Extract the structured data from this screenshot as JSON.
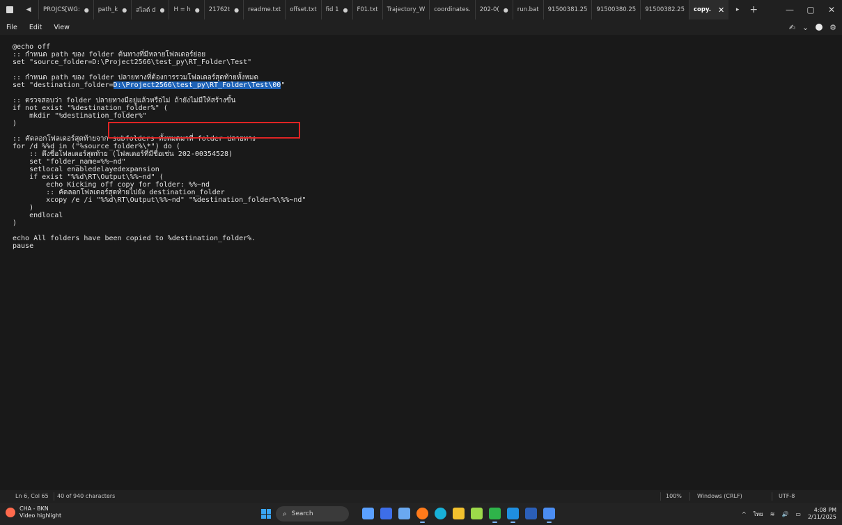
{
  "tabs": [
    {
      "label": "PROJCS[WG:",
      "dirty": "●"
    },
    {
      "label": "path_k",
      "dirty": "●"
    },
    {
      "label": "สไลด์ d",
      "dirty": "●"
    },
    {
      "label": "H = h",
      "dirty": "●"
    },
    {
      "label": "21762t",
      "dirty": "●"
    },
    {
      "label": "readme.txt",
      "dirty": ""
    },
    {
      "label": "offset.txt",
      "dirty": ""
    },
    {
      "label": "fid 1",
      "dirty": "●"
    },
    {
      "label": "F01.txt",
      "dirty": ""
    },
    {
      "label": "Trajectory_W",
      "dirty": ""
    },
    {
      "label": "coordinates.",
      "dirty": ""
    },
    {
      "label": "202-0(",
      "dirty": "●"
    },
    {
      "label": "run.bat",
      "dirty": ""
    },
    {
      "label": "91500381.25",
      "dirty": ""
    },
    {
      "label": "91500380.25",
      "dirty": ""
    },
    {
      "label": "91500382.25",
      "dirty": ""
    }
  ],
  "active_tab": {
    "label": "copy.",
    "close": "✕"
  },
  "tab_controls": {
    "back": "◀",
    "more": "▸",
    "add": "+"
  },
  "window_controls": {
    "minimize": "—",
    "maximize": "▢",
    "close": "✕"
  },
  "menu": {
    "file": "File",
    "edit": "Edit",
    "view": "View"
  },
  "menu_right": {
    "copilot": "✍",
    "chevron": "⌄",
    "settings": "⚙"
  },
  "code": {
    "before_selection": "@echo off\n:: กำหนด path ของ folder ต้นทางที่มีหลายโฟลเดอร์ย่อย\nset \"source_folder=D:\\Project2566\\test_py\\RT_Folder\\Test\"\n\n:: กำหนด path ของ folder ปลายทางที่ต้องการรวมโฟลเดอร์สุดท้ายทั้งหมด\nset \"destination_folder=",
    "selection": "D:\\Project2566\\test_py\\RT_Folder\\Test\\00",
    "after_selection": "\"\n\n:: ตรวจสอบว่า folder ปลายทางมีอยู่แล้วหรือไม่ ถ้ายังไม่มีให้สร้างขึ้น\nif not exist \"%destination_folder%\" (\n    mkdir \"%destination_folder%\"\n)\n\n:: คัดลอกโฟลเดอร์สุดท้ายจาก subfolders ทั้งหมดมาที่ folder ปลายทาง\nfor /d %%d in (\"%source_folder%\\*\") do (\n    :: ดึงชื่อโฟลเดอร์สุดท้าย (โฟลเดอร์ที่มีชื่อเช่น 202-00354528)\n    set \"folder_name=%%~nd\"\n    setlocal enabledelayedexpansion\n    if exist \"%%d\\RT\\Output\\%%~nd\" (\n        echo Kicking off copy for folder: %%~nd\n        :: คัดลอกโฟลเดอร์สุดท้ายไปยัง destination_folder\n        xcopy /e /i \"%%d\\RT\\Output\\%%~nd\" \"%destination_folder%\\%%~nd\"\n    )\n    endlocal\n)\n\necho All folders have been copied to %destination_folder%.\npause"
  },
  "status": {
    "position": "Ln 6, Col 65",
    "selection": "40 of 940 characters",
    "zoom": "100%",
    "line_ending": "Windows (CRLF)",
    "encoding": "UTF-8"
  },
  "taskbar": {
    "weather_title": "CHA - BKN",
    "weather_sub": "Video highlight",
    "search": "Search",
    "tray_chevron": "^",
    "lang": "ไทย",
    "wifi": "≋",
    "volume": "🔊",
    "battery": "▭",
    "time": "4:08 PM",
    "date": "2/11/2025"
  },
  "colors": {
    "selection": "#1d62b8",
    "annotation_box": "#e02424",
    "editor_bg": "#191919"
  }
}
